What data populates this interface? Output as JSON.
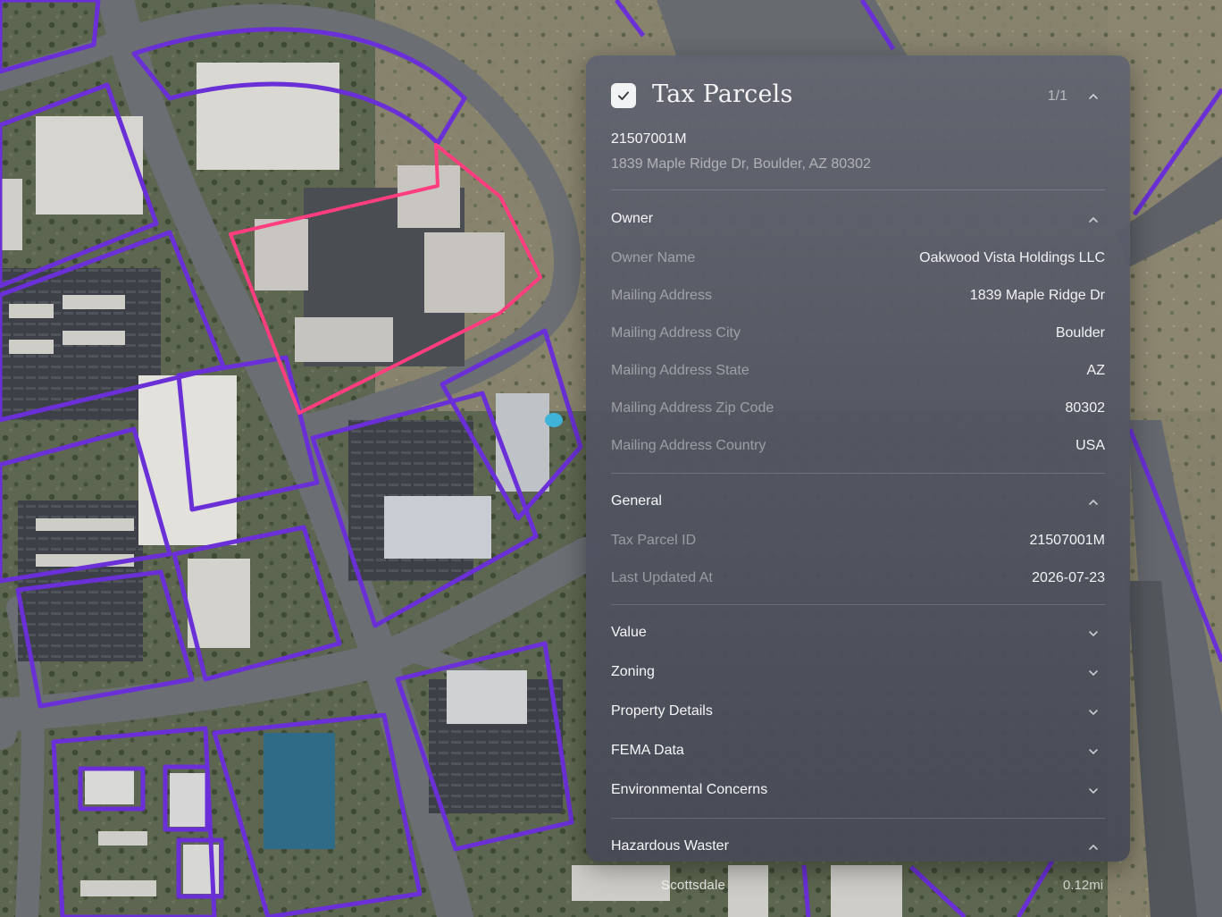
{
  "map": {
    "place_label": "Scottsdale",
    "scale_label": "0.12mi",
    "colors": {
      "parcel_line": "#6a2fd6",
      "selected_parcel": "#ff3d7f"
    }
  },
  "panel": {
    "layer_title": "Tax Parcels",
    "layer_checked": true,
    "pager": "1/1",
    "parcel_id": "21507001M",
    "address": "1839 Maple Ridge Dr, Boulder, AZ 80302",
    "sections": {
      "owner": {
        "title": "Owner",
        "expanded": true,
        "rows": [
          {
            "label": "Owner Name",
            "value": "Oakwood Vista Holdings LLC"
          },
          {
            "label": "Mailing Address",
            "value": "1839 Maple Ridge Dr"
          },
          {
            "label": "Mailing Address City",
            "value": "Boulder"
          },
          {
            "label": "Mailing Address State",
            "value": "AZ"
          },
          {
            "label": "Mailing Address Zip Code",
            "value": "80302"
          },
          {
            "label": "Mailing Address Country",
            "value": "USA"
          }
        ]
      },
      "general": {
        "title": "General",
        "expanded": true,
        "rows": [
          {
            "label": "Tax Parcel ID",
            "value": "21507001M"
          },
          {
            "label": "Last Updated At",
            "value": "2026-07-23"
          }
        ]
      },
      "collapsed": [
        {
          "title": "Value",
          "expanded": false
        },
        {
          "title": "Zoning",
          "expanded": false
        },
        {
          "title": "Property Details",
          "expanded": false
        },
        {
          "title": "FEMA Data",
          "expanded": false
        },
        {
          "title": "Environmental Concerns",
          "expanded": false
        }
      ],
      "hazardous": {
        "title": "Hazardous Waster",
        "expanded": true
      }
    }
  },
  "icons": {
    "check": "check-icon",
    "expand": "chevron-up-icon",
    "collapse": "chevron-down-icon"
  }
}
